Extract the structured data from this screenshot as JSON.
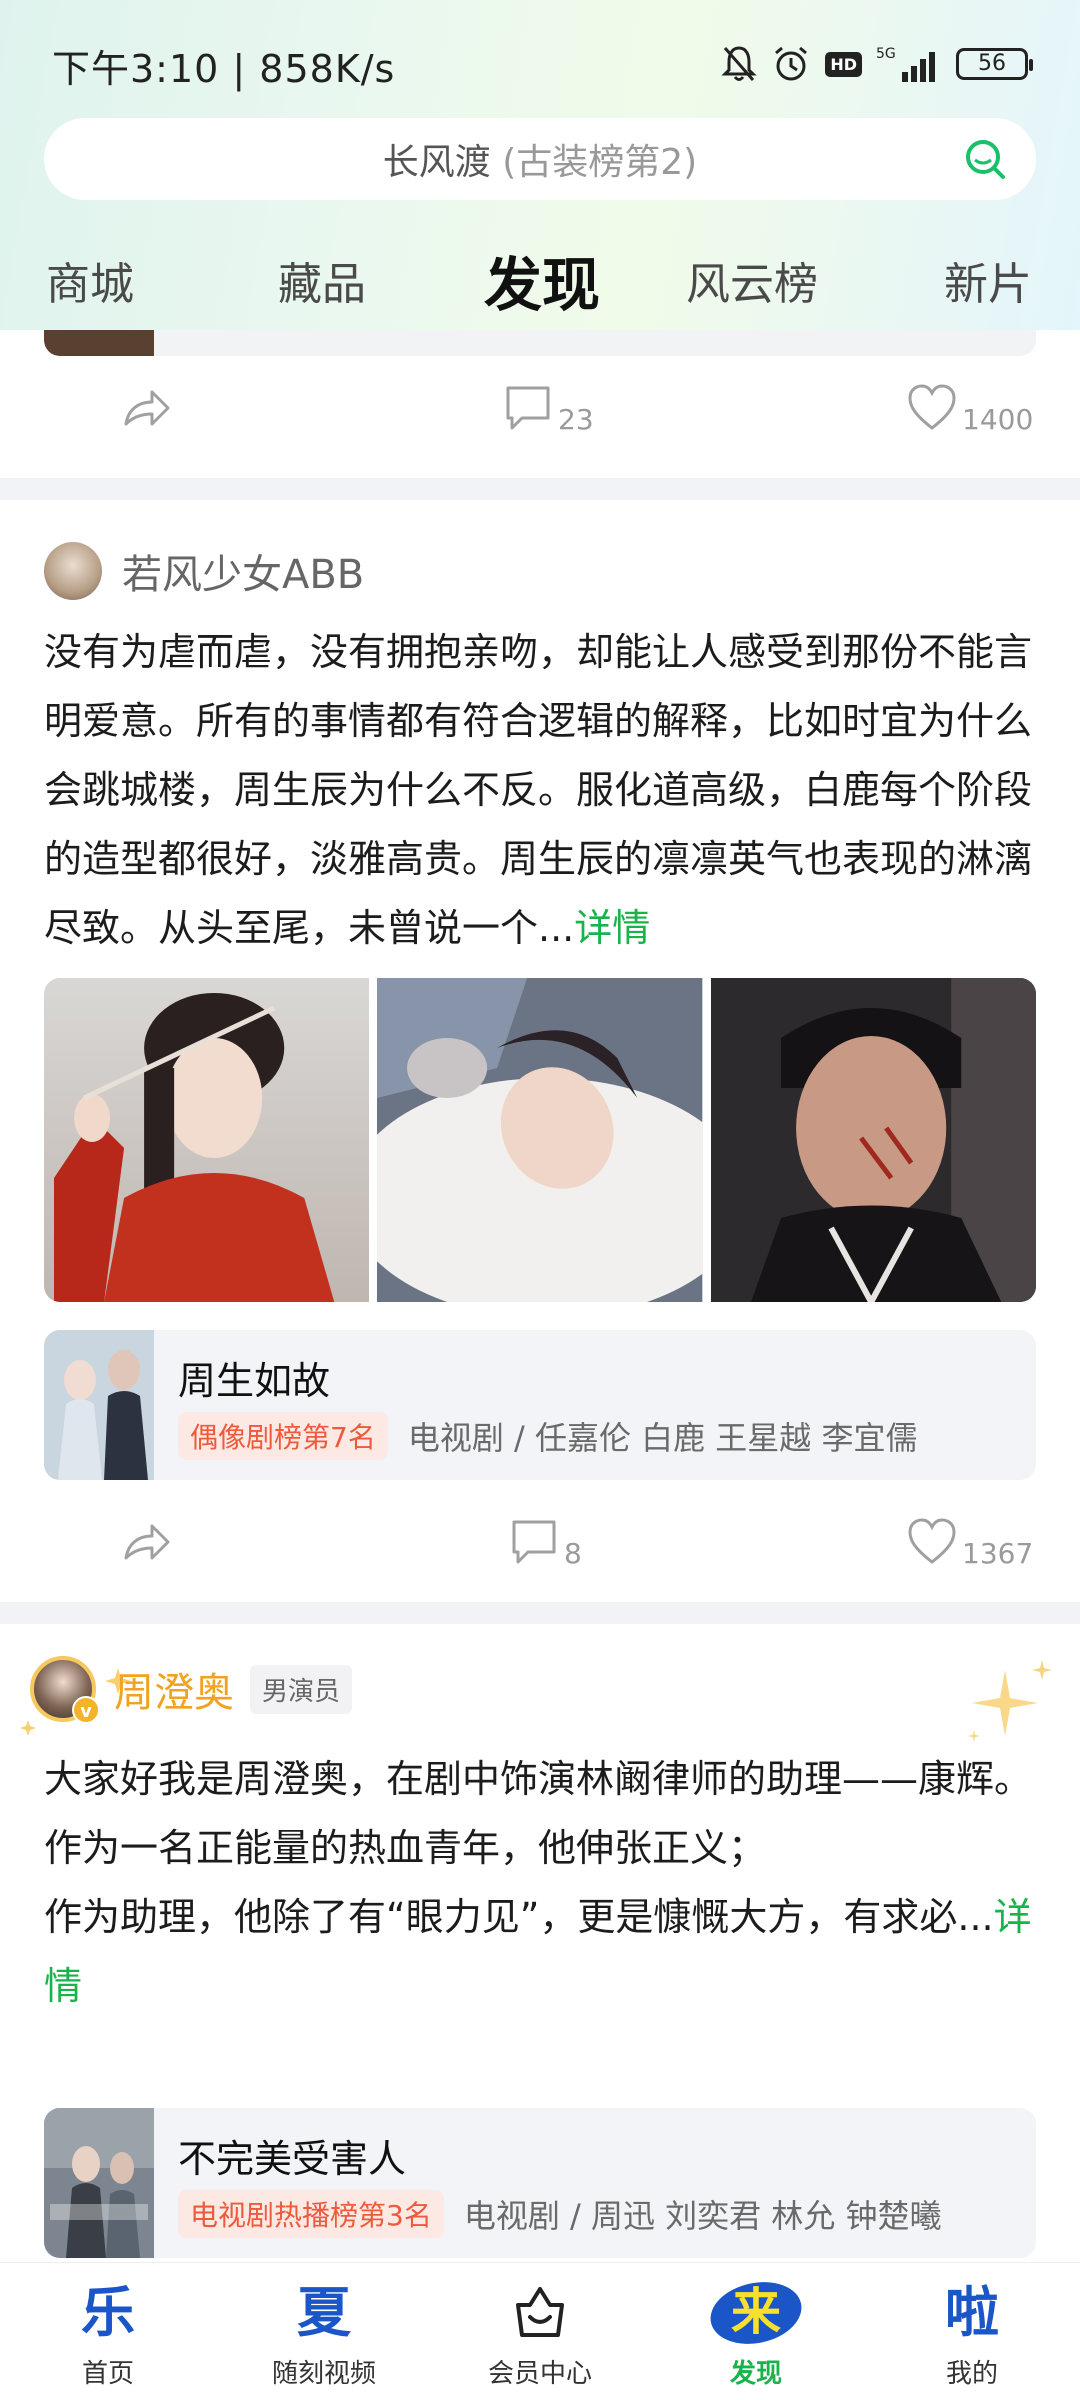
{
  "status_bar": {
    "time": "下午3:10 | 858K/s",
    "network": "5G",
    "battery": "56"
  },
  "search": {
    "main": "长风渡",
    "hint": "(古装榜第2)",
    "icon": "search-icon"
  },
  "tabs": [
    {
      "label": "商城"
    },
    {
      "label": "藏品"
    },
    {
      "label": "发现",
      "active": true
    },
    {
      "label": "风云榜"
    },
    {
      "label": "新片"
    }
  ],
  "prev_post": {
    "share_icon": "share-icon",
    "comments": "23",
    "likes": "1400"
  },
  "post1": {
    "author": "若风少女ABB",
    "text": "没有为虐而虐，没有拥抱亲吻，却能让人感受到那份不能言明爱意。所有的事情都有符合逻辑的解释，比如时宜为什么会跳城楼，周生辰为什么不反。服化道高级，白鹿每个阶段的造型都很好，淡雅高贵。周生辰的凛凛英气也表现的淋漓尽致。从头至尾，未曾说一个...",
    "detail": "详情",
    "show": {
      "title": "周生如故",
      "rank": "偶像剧榜第7名",
      "meta": "电视剧 / 任嘉伦 白鹿 王星越 李宜儒"
    },
    "comments": "8",
    "likes": "1367"
  },
  "post2": {
    "author": "周澄奥",
    "role": "男演员",
    "verified_mark": "v",
    "lines": [
      "大家好我是周澄奥，在剧中饰演林阚律师的助理——康辉。",
      "作为一名正能量的热血青年，他伸张正义；",
      "作为助理，他除了有“眼力见”，更是慷慨大方，有求必..."
    ],
    "detail": "详情",
    "show": {
      "title": "不完美受害人",
      "rank": "电视剧热播榜第3名",
      "meta": "电视剧 / 周迅 刘奕君 林允 钟楚曦"
    }
  },
  "bottom_nav": [
    {
      "glyph": "乐",
      "label": "首页"
    },
    {
      "glyph": "夏",
      "label": "随刻视频"
    },
    {
      "glyph": "",
      "label": "会员中心"
    },
    {
      "glyph": "来",
      "label": "发现",
      "active": true
    },
    {
      "glyph": "啦",
      "label": "我的"
    }
  ],
  "colors": {
    "accent_green": "#18b34a",
    "rank_red": "#ee5a3c",
    "celebrity_gold": "#f0a320",
    "nav_blue": "#1a56c7"
  }
}
